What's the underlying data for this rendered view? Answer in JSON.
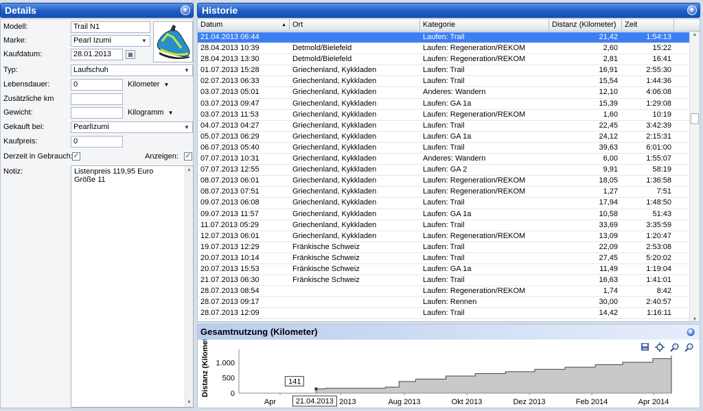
{
  "details": {
    "title": "Details",
    "modell_label": "Modell:",
    "modell_value": "Trail N1",
    "marke_label": "Marke:",
    "marke_value": "Pearl Izumi",
    "kaufdatum_label": "Kaufdatum:",
    "kaufdatum_value": "28.01.2013",
    "typ_label": "Typ:",
    "typ_value": "Laufschuh",
    "lebensdauer_label": "Lebensdauer:",
    "lebensdauer_value": "0",
    "lebensdauer_unit": "Kilometer",
    "zusatz_label": "Zusätzliche km",
    "zusatz_value": "",
    "gewicht_label": "Gewicht:",
    "gewicht_value": "",
    "gewicht_unit": "Kilogramm",
    "gekauft_label": "Gekauft bei:",
    "gekauft_value": "PearlIzumi",
    "kaufpreis_label": "Kaufpreis:",
    "kaufpreis_value": "0",
    "gebrauch_label": "Derzeit in Gebrauch:",
    "gebrauch_checked": true,
    "anzeigen_label": "Anzeigen:",
    "anzeigen_checked": true,
    "notiz_label": "Notiz:",
    "notiz_line1": "Listenpreis 119,95 Euro",
    "notiz_line2": "Größe 11"
  },
  "historie": {
    "title": "Historie",
    "columns": [
      "Datum",
      "Ort",
      "Kategorie",
      "Distanz (Kilometer)",
      "Zeit"
    ],
    "rows": [
      [
        "21.04.2013 06:44",
        "",
        "Laufen: Trail",
        "21,42",
        "1:54:13"
      ],
      [
        "28.04.2013 10:39",
        "Detmold/Bielefeld",
        "Laufen: Regeneration/REKOM",
        "2,60",
        "15:22"
      ],
      [
        "28.04.2013 13:30",
        "Detmold/Bielefeld",
        "Laufen: Regeneration/REKOM",
        "2,81",
        "16:41"
      ],
      [
        "01.07.2013 15:28",
        "Griechenland, Kykkladen",
        "Laufen: Trail",
        "16,91",
        "2:55:30"
      ],
      [
        "02.07.2013 06:33",
        "Griechenland, Kykkladen",
        "Laufen: Trail",
        "15,54",
        "1:44:36"
      ],
      [
        "03.07.2013 05:01",
        "Griechenland, Kykkladen",
        "Anderes: Wandern",
        "12,10",
        "4:06:08"
      ],
      [
        "03.07.2013 09:47",
        "Griechenland, Kykkladen",
        "Laufen: GA 1a",
        "15,39",
        "1:29:08"
      ],
      [
        "03.07.2013 11:53",
        "Griechenland, Kykkladen",
        "Laufen: Regeneration/REKOM",
        "1,60",
        "10:19"
      ],
      [
        "04.07.2013 04:27",
        "Griechenland, Kykkladen",
        "Laufen: Trail",
        "22,45",
        "3:42:39"
      ],
      [
        "05.07.2013 06:29",
        "Griechenland, Kykkladen",
        "Laufen: GA 1a",
        "24,12",
        "2:15:31"
      ],
      [
        "06.07.2013 05:40",
        "Griechenland, Kykkladen",
        "Laufen: Trail",
        "39,63",
        "6:01:00"
      ],
      [
        "07.07.2013 10:31",
        "Griechenland, Kykkladen",
        "Anderes: Wandern",
        "6,00",
        "1:55:07"
      ],
      [
        "07.07.2013 12:55",
        "Griechenland, Kykkladen",
        "Laufen: GA 2",
        "9,91",
        "58:19"
      ],
      [
        "08.07.2013 06:01",
        "Griechenland, Kykkladen",
        "Laufen: Regeneration/REKOM",
        "18,05",
        "1:36:58"
      ],
      [
        "08.07.2013 07:51",
        "Griechenland, Kykkladen",
        "Laufen: Regeneration/REKOM",
        "1,27",
        "7:51"
      ],
      [
        "09.07.2013 06:08",
        "Griechenland, Kykkladen",
        "Laufen: Trail",
        "17,94",
        "1:48:50"
      ],
      [
        "09.07.2013 11:57",
        "Griechenland, Kykkladen",
        "Laufen: GA 1a",
        "10,58",
        "51:43"
      ],
      [
        "11.07.2013 05:29",
        "Griechenland, Kykkladen",
        "Laufen: Trail",
        "33,69",
        "3:35:59"
      ],
      [
        "12.07.2013 06:01",
        "Griechenland, Kykkladen",
        "Laufen: Regeneration/REKOM",
        "13,09",
        "1:20:47"
      ],
      [
        "19.07.2013 12:29",
        "Fränkische Schweiz",
        "Laufen: Trail",
        "22,09",
        "2:53:08"
      ],
      [
        "20.07.2013 10:14",
        "Fränkische Schweiz",
        "Laufen: Trail",
        "27,45",
        "5:20:02"
      ],
      [
        "20.07.2013 15:53",
        "Fränkische Schweiz",
        "Laufen: GA 1a",
        "11,49",
        "1:19:04"
      ],
      [
        "21.07.2013 06:30",
        "Fränkische Schweiz",
        "Laufen: Trail",
        "16,63",
        "1:41:01"
      ],
      [
        "28.07.2013 08:54",
        "",
        "Laufen: Regeneration/REKOM",
        "1,74",
        "8:42"
      ],
      [
        "28.07.2013 09:17",
        "",
        "Laufen: Rennen",
        "30,00",
        "2:40:57"
      ],
      [
        "28.07.2013 12:09",
        "",
        "Laufen: Trail",
        "14,42",
        "1:16:11"
      ]
    ]
  },
  "chart": {
    "title": "Gesamtnutzung (Kilometer)",
    "tooltip_value": "141",
    "cursor_date": "21.04.2013"
  },
  "chart_data": {
    "type": "area",
    "ylabel": "Distanz (Kilometer)",
    "yticks": [
      "1.000",
      "500",
      "0"
    ],
    "ytick_values": [
      1000,
      500,
      0
    ],
    "ylim": [
      0,
      1300
    ],
    "xticks": [
      "Apr",
      "Jun 2013",
      "Aug 2013",
      "Okt 2013",
      "Dez 2013",
      "Feb 2014",
      "Apr 2014"
    ],
    "x": [
      "2013-02-01",
      "2013-04-21",
      "2013-05-01",
      "2013-07-01",
      "2013-07-15",
      "2013-08-01",
      "2013-09-01",
      "2013-10-01",
      "2013-11-01",
      "2013-12-01",
      "2014-01-01",
      "2014-02-01",
      "2014-03-01",
      "2014-04-01",
      "2014-04-20"
    ],
    "values": [
      0,
      141,
      160,
      200,
      380,
      460,
      560,
      640,
      700,
      780,
      850,
      930,
      1010,
      1130,
      1230
    ],
    "grid": false,
    "legend": "none"
  }
}
